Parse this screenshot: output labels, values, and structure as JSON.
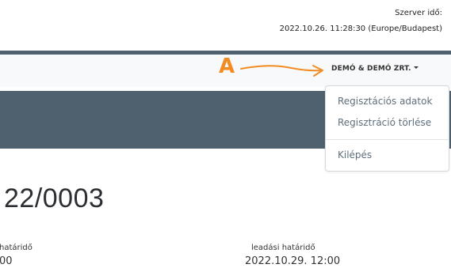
{
  "server_time": {
    "label": "Szerver idő:",
    "value": "2022.10.26. 11:28:30 (Europe/Budapest)"
  },
  "user_menu": {
    "label": "DEMÓ & DEMÓ ZRT.",
    "items": [
      {
        "label": "Regisztációs adatok"
      },
      {
        "label": "Regisztráció törlése"
      },
      {
        "label": "Kilépés"
      }
    ]
  },
  "annotation": {
    "letter": "A",
    "color": "#f28b22"
  },
  "main": {
    "title": "22/0003",
    "fields": [
      {
        "label": "határidő",
        "value": "00"
      },
      {
        "label": "leadási határidő",
        "value": "2022.10.29. 12:00"
      }
    ]
  },
  "colors": {
    "banner": "#4f606e",
    "navbar": "#f8f9fa",
    "menu_item_text": "#5e6f7c"
  }
}
